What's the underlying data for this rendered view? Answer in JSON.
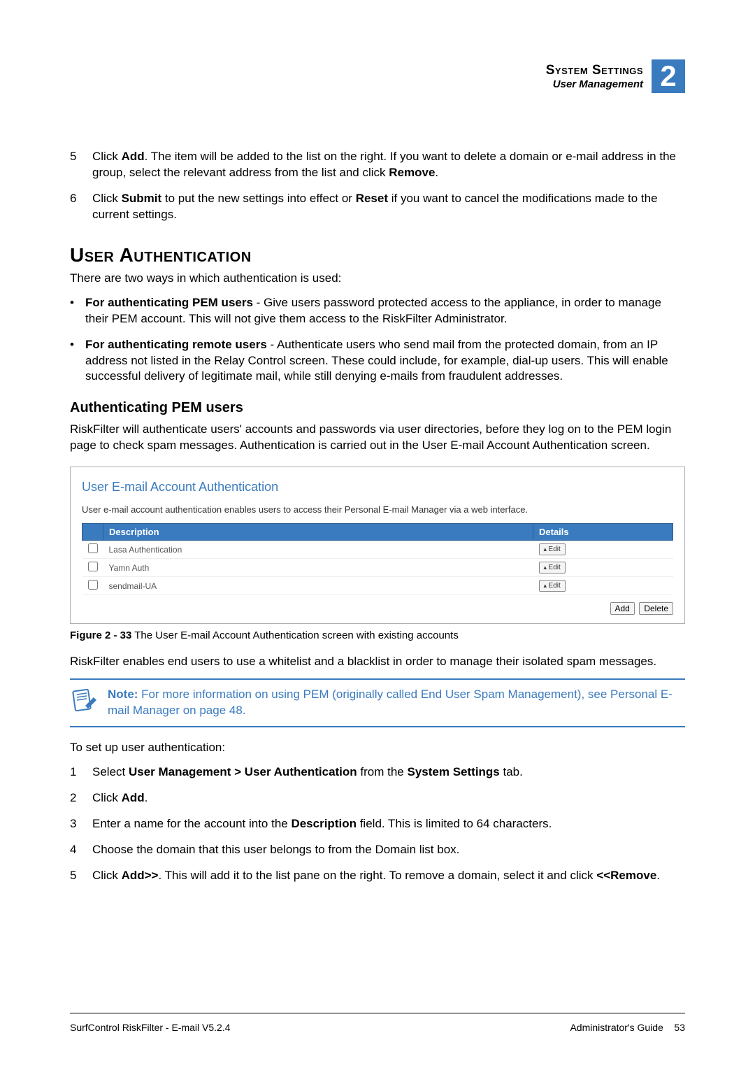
{
  "header": {
    "title": "System Settings",
    "subtitle": "User Management",
    "chapter": "2"
  },
  "topSteps": [
    {
      "num": "5",
      "html": "Click <b>Add</b>. The item will be added to the list on the right. If you want to delete a domain or e-mail address in the group, select the relevant address from the list and click <b>Remove</b>."
    },
    {
      "num": "6",
      "html": "Click <b>Submit</b> to put the new settings into effect or <b>Reset</b> if you want to cancel the modifications made to the current settings."
    }
  ],
  "section": {
    "heading": "User Authentication",
    "intro": "There are two ways in which authentication is used:",
    "bullets": [
      "<b>For authenticating PEM users</b> - Give users password protected access to the appliance, in order to manage their PEM account. This will not give them access to the RiskFilter Administrator.",
      "<b>For authenticating remote users</b> - Authenticate users who send mail from the protected domain, from an IP address not listed in the Relay Control screen. These could include, for example, dial-up users. This will enable successful delivery of legitimate mail, while still denying e-mails from fraudulent addresses."
    ]
  },
  "pemSection": {
    "heading": "Authenticating PEM users",
    "para": "RiskFilter will authenticate users' accounts and passwords via user directories, before they log on to the PEM login page to check spam messages. Authentication is carried out in the User E-mail Account Authentication screen."
  },
  "panel": {
    "title": "User E-mail Account Authentication",
    "desc": "User e-mail account authentication enables users to access their Personal E-mail Manager via a web interface.",
    "cols": {
      "desc": "Description",
      "details": "Details"
    },
    "rows": [
      {
        "desc": "Lasa Authentication",
        "btn": "Edit"
      },
      {
        "desc": "Yamn Auth",
        "btn": "Edit"
      },
      {
        "desc": "sendmail-UA",
        "btn": "Edit"
      }
    ],
    "actions": {
      "add": "Add",
      "delete": "Delete"
    }
  },
  "figureCaption": {
    "label": "Figure 2 - 33",
    "text": " The User E-mail Account Authentication screen with existing accounts"
  },
  "afterFigurePara": "RiskFilter enables end users to use a whitelist and a blacklist in order to manage their isolated spam messages.",
  "note": {
    "label": "Note:",
    "text": "  For more information on using PEM (originally called End User Spam Management), see Personal E-mail Manager on page 48."
  },
  "setup": {
    "intro": "To set up user authentication:",
    "steps": [
      {
        "num": "1",
        "html": "Select <b>User Management > User Authentication</b> from the <b>System Settings</b> tab."
      },
      {
        "num": "2",
        "html": "Click <b>Add</b>."
      },
      {
        "num": "3",
        "html": "Enter a name for the account into the <b>Description</b> field. This is limited to 64 characters."
      },
      {
        "num": "4",
        "html": "Choose the domain that this user belongs to from the Domain list box."
      },
      {
        "num": "5",
        "html": "Click <b>Add>></b>. This will add it to the list pane on the right. To remove a domain, select it and click <b>&lt;&lt;Remove</b>."
      }
    ]
  },
  "footer": {
    "left": "SurfControl RiskFilter - E-mail V5.2.4",
    "rightLabel": "Administrator's Guide",
    "pageNum": "53"
  }
}
